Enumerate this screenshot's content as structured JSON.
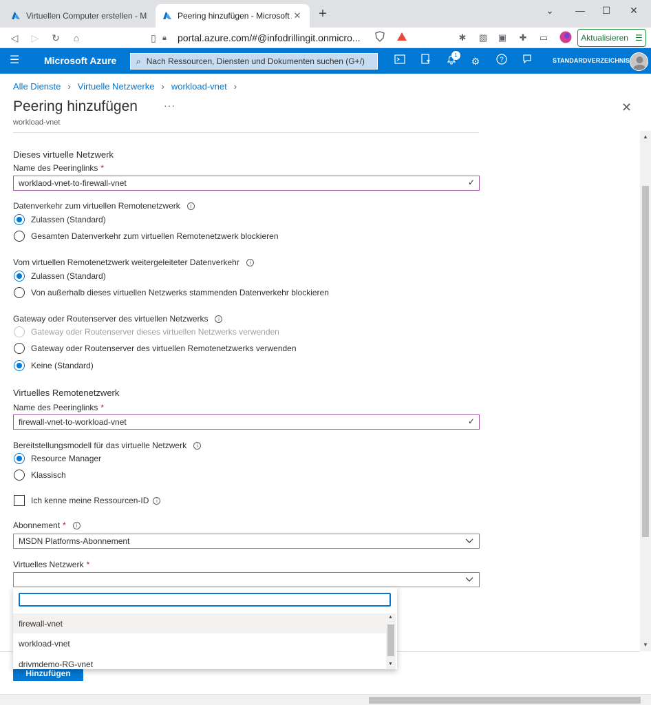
{
  "browser": {
    "tabs": [
      {
        "title": "Virtuellen Computer erstellen - Microsoft",
        "active": false
      },
      {
        "title": "Peering hinzufügen - Microsoft Azur",
        "active": true
      }
    ],
    "new_tab_icon": "plus-icon",
    "url": "portal.azure.com/#@infodrillingit.onmicro...",
    "update_label": "Aktualisieren"
  },
  "azure": {
    "brand": "Microsoft Azure",
    "search_placeholder": "Nach Ressourcen, Diensten und Dokumenten suchen (G+/)",
    "notification_count": "1",
    "directory": "STANDARDVERZEICHNIS"
  },
  "breadcrumb": [
    "Alle Dienste",
    "Virtuelle Netzwerke",
    "workload-vnet"
  ],
  "page": {
    "title": "Peering hinzufügen",
    "more": "···",
    "subtitle": "workload-vnet"
  },
  "local": {
    "section": "Dieses virtuelle Netzwerk",
    "name_label": "Name des Peeringlinks",
    "name_value": "worklaod-vnet-to-firewall-vnet",
    "traffic_label": "Datenverkehr zum virtuellen Remotenetzwerk",
    "traffic_options": [
      "Zulassen (Standard)",
      "Gesamten Datenverkehr zum virtuellen Remotenetzwerk blockieren"
    ],
    "forwarded_label": "Vom virtuellen Remotenetzwerk weitergeleiteter Datenverkehr",
    "forwarded_options": [
      "Zulassen (Standard)",
      "Von außerhalb dieses virtuellen Netzwerks stammenden Datenverkehr blockieren"
    ],
    "gateway_label": "Gateway oder Routenserver des virtuellen Netzwerks",
    "gateway_options": [
      "Gateway oder Routenserver dieses virtuellen Netzwerks verwenden",
      "Gateway oder Routenserver des virtuellen Remotenetzwerks verwenden",
      "Keine (Standard)"
    ]
  },
  "remote": {
    "section": "Virtuelles Remotenetzwerk",
    "name_label": "Name des Peeringlinks",
    "name_value": "firewall-vnet-to-workload-vnet",
    "deploy_label": "Bereitstellungsmodell für das virtuelle Netzwerk",
    "deploy_options": [
      "Resource Manager",
      "Klassisch"
    ],
    "resource_id_label": "Ich kenne meine Ressourcen-ID",
    "subscription_label": "Abonnement",
    "subscription_value": "MSDN Platforms-Abonnement",
    "vnet_label": "Virtuelles Netzwerk",
    "vnet_value": "",
    "dropdown_items": [
      "firewall-vnet",
      "workload-vnet",
      "drivmdemo-RG-vnet"
    ]
  },
  "actions": {
    "add_label": "Hinzufügen"
  },
  "colors": {
    "azure_blue": "#0078d4",
    "required": "#a4262c"
  }
}
